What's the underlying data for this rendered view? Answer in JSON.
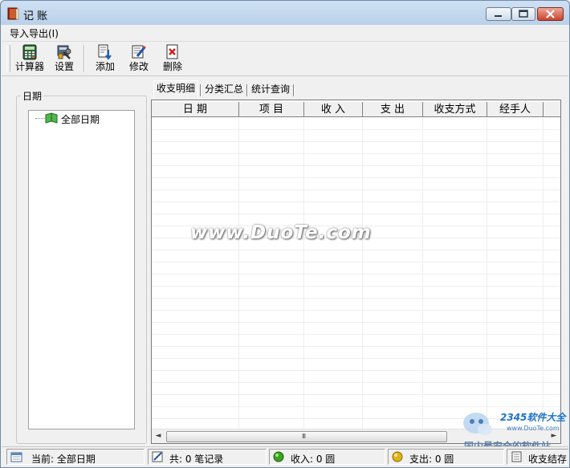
{
  "window": {
    "title": "记 账"
  },
  "menu": {
    "items": [
      {
        "label": "导入导出(I)"
      }
    ]
  },
  "toolbar": {
    "buttons": [
      {
        "label": "计算器",
        "icon": "calculator-icon"
      },
      {
        "label": "设置",
        "icon": "settings-tools-icon"
      },
      {
        "label": "添加",
        "icon": "add-document-icon"
      },
      {
        "label": "修改",
        "icon": "edit-document-icon"
      },
      {
        "label": "删除",
        "icon": "delete-document-icon"
      }
    ]
  },
  "left_panel": {
    "group_label": "日期",
    "tree": [
      {
        "label": "全部日期",
        "icon": "book-icon"
      }
    ]
  },
  "tabs": [
    {
      "label": "收支明细",
      "active": true
    },
    {
      "label": "分类汇总",
      "active": false
    },
    {
      "label": "统计查询",
      "active": false
    }
  ],
  "table": {
    "columns": [
      "日 期",
      "项 目",
      "收 入",
      "支 出",
      "收支方式",
      "经手人"
    ],
    "rows": []
  },
  "watermark": "www.DuoTe.com",
  "logo": {
    "brand": "2345软件大全",
    "url": "www.DuoTe.com",
    "slogan": "国内最安全的软件站"
  },
  "statusbar": {
    "current": "当前: 全部日期",
    "total": "共: 0 笔记录",
    "income": "收入: 0 圆",
    "expense": "支出: 0 圆",
    "balance": "收支结存"
  },
  "colors": {
    "income_dot": "#3aa31f",
    "expense_dot": "#e1b318",
    "close_button": "#c9432b"
  }
}
